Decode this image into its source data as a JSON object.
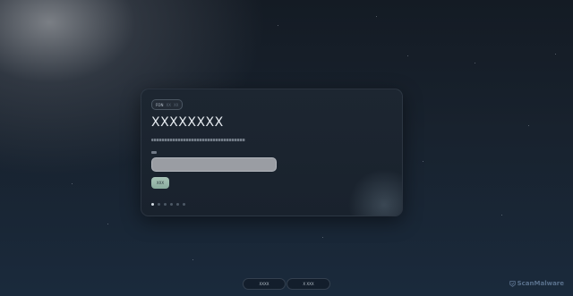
{
  "card": {
    "badge": {
      "primary": "FON",
      "secondary": "XX",
      "tertiary": "XX"
    },
    "title": "XXXXXXXX",
    "description": "",
    "field_label": "",
    "input": {
      "value": "",
      "placeholder": ""
    },
    "submit_label": "XXX",
    "dots": {
      "count": 6,
      "active_index": 0
    }
  },
  "bottom_bar": {
    "left_label": "XXXX",
    "right_label": "X XXX"
  },
  "watermark": {
    "text": "ScanMalware"
  },
  "colors": {
    "accent": "#98b6a8",
    "card_bg": "#1b2430"
  }
}
